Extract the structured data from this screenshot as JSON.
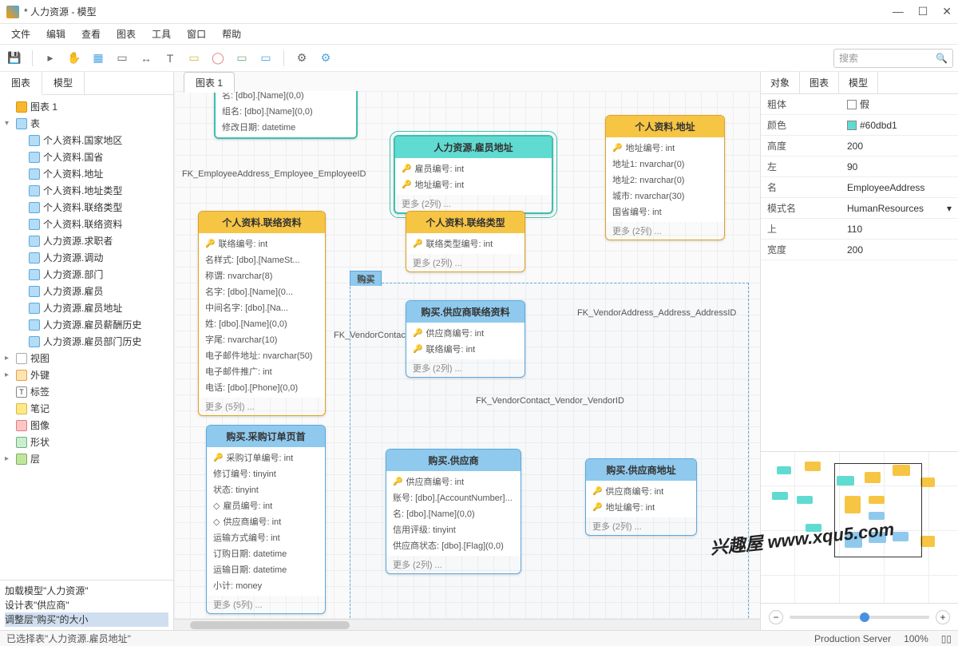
{
  "window": {
    "title": "* 人力资源 - 模型"
  },
  "menu": [
    "文件",
    "编辑",
    "查看",
    "图表",
    "工具",
    "窗口",
    "帮助"
  ],
  "search_placeholder": "搜索",
  "left": {
    "tabs": [
      "图表",
      "模型"
    ],
    "root_diagram": "图表 1",
    "table_group": "表",
    "tables": [
      "个人资料.国家地区",
      "个人资料.国省",
      "个人资料.地址",
      "个人资料.地址类型",
      "个人资料.联络类型",
      "个人资料.联络资料",
      "人力资源.求职者",
      "人力资源.调动",
      "人力资源.部门",
      "人力资源.雇员",
      "人力资源.雇员地址",
      "人力资源.雇员薪酬历史",
      "人力资源.雇员部门历史"
    ],
    "groups": [
      "视图",
      "外键",
      "标签",
      "笔记",
      "图像",
      "形状",
      "层"
    ],
    "log": [
      "加载模型\"人力资源\"",
      "设计表\"供应商\"",
      "调整层\"购买\"的大小"
    ]
  },
  "canvas": {
    "tab": "图表 1",
    "layer_tag": "购买",
    "layer_tag2": "购买",
    "top_entity": {
      "rows": [
        "名: [dbo].[Name](0,0)",
        "组名: [dbo].[Name](0,0)",
        "修改日期: datetime"
      ]
    },
    "emp_addr": {
      "title": "人力资源.雇员地址",
      "rows": [
        "雇员编号: int",
        "地址编号: int"
      ],
      "more": "更多  (2列)  ..."
    },
    "person_addr": {
      "title": "个人资料.地址",
      "rows": [
        "地址编号: int",
        "地址1: nvarchar(0)",
        "地址2: nvarchar(0)",
        "城市: nvarchar(30)",
        "国省编号: int"
      ],
      "more": "更多  (2列)  ..."
    },
    "contact_info": {
      "title": "个人资料.联络资料",
      "rows": [
        "联络编号: int",
        "名样式: [dbo].[NameSt...",
        "称谓: nvarchar(8)",
        "名字: [dbo].[Name](0...",
        "中间名字: [dbo].[Na...",
        "姓: [dbo].[Name](0,0)",
        "字尾: nvarchar(10)",
        "电子邮件地址: nvarchar(50)",
        "电子邮件推广: int",
        "电话: [dbo].[Phone](0,0)"
      ],
      "more": "更多  (5列)  ..."
    },
    "contact_type": {
      "title": "个人资料.联络类型",
      "rows": [
        "联络类型编号: int"
      ],
      "more": "更多  (2列)  ..."
    },
    "vendor_contact": {
      "title": "购买.供应商联络资料",
      "rows": [
        "供应商编号: int",
        "联络编号: int"
      ],
      "more": "更多  (2列)  ..."
    },
    "po_header": {
      "title": "购买.采购订单页首",
      "rows": [
        "采购订单编号: int",
        "修订编号: tinyint",
        "状态: tinyint",
        "雇员编号: int",
        "供应商编号: int",
        "运输方式编号: int",
        "订购日期: datetime",
        "运输日期: datetime",
        "小计: money"
      ],
      "more": "更多  (5列)  ..."
    },
    "vendor": {
      "title": "购买.供应商",
      "rows": [
        "供应商编号: int",
        "账号: [dbo].[AccountNumber]...",
        "名: [dbo].[Name](0,0)",
        "信用评级: tinyint",
        "供应商状态: [dbo].[Flag](0,0)"
      ],
      "more": "更多  (2列)  ..."
    },
    "vendor_addr": {
      "title": "购买.供应商地址",
      "rows": [
        "供应商编号: int",
        "地址编号: int"
      ],
      "more": "更多  (2列)  ..."
    },
    "fk_labels": {
      "emp": "FK_EmployeeAddress_Employee_EmployeeID",
      "vc": "FK_VendorContact",
      "vcv": "FK_VendorContact_Vendor_VendorID",
      "va": "FK_VendorAddress_Address_AddressID"
    }
  },
  "right": {
    "tabs": [
      "对象",
      "图表",
      "模型"
    ],
    "props": [
      {
        "k": "粗体",
        "v": "假",
        "checkbox": true
      },
      {
        "k": "颜色",
        "v": "#60dbd1",
        "color": "#60dbd1"
      },
      {
        "k": "高度",
        "v": "200"
      },
      {
        "k": "左",
        "v": "90"
      },
      {
        "k": "名",
        "v": "EmployeeAddress"
      },
      {
        "k": "模式名",
        "v": "HumanResources",
        "dropdown": true
      },
      {
        "k": "上",
        "v": "110"
      },
      {
        "k": "宽度",
        "v": "200"
      }
    ]
  },
  "zoom": {
    "minus": "−",
    "plus": "+"
  },
  "status": {
    "left": "已选择表\"人力资源.雇员地址\"",
    "server": "Production Server",
    "zoom": "100%"
  },
  "watermark": "兴趣屋 www.xqu5.com"
}
